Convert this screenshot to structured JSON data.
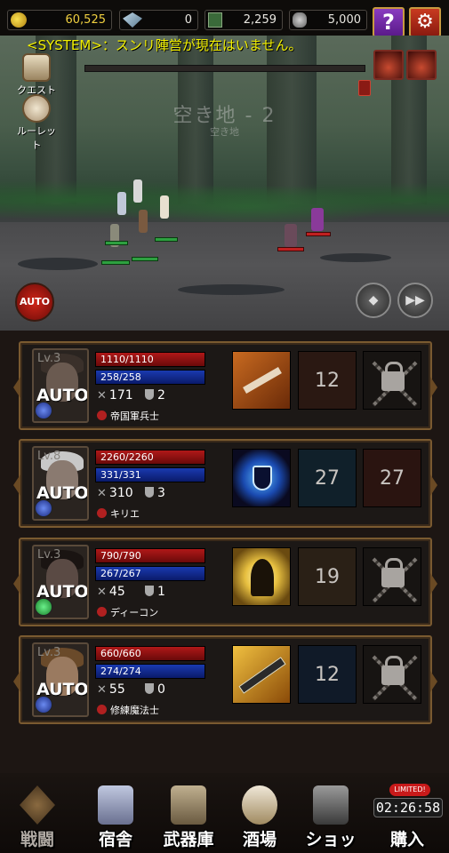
{
  "resources": {
    "gold": "60,525",
    "gems": "0",
    "cards": "2,259",
    "ore": "5,000"
  },
  "header": {
    "help_icon": "?",
    "settings_icon": "gear-icon"
  },
  "scene": {
    "system_message": "<SYSTEM>：スンリ陣営が現在はいません。",
    "stage_title": "空き地 - 2",
    "stage_subtitle": "空き地",
    "quest_label": "クエスト",
    "roulette_label": "ルーレット",
    "auto_button": "AUTO"
  },
  "heroes": [
    {
      "level": "Lv.3",
      "hp": "1110/1110",
      "mp": "258/258",
      "atk": "171",
      "def": "2",
      "name": "帝国軍兵士",
      "mode": "AUTO",
      "skill2": "12",
      "skill3_locked": true
    },
    {
      "level": "Lv.8",
      "hp": "2260/2260",
      "mp": "331/331",
      "atk": "310",
      "def": "3",
      "name": "キリエ",
      "mode": "AUTO",
      "skill2": "27",
      "skill3": "27"
    },
    {
      "level": "Lv.3",
      "hp": "790/790",
      "mp": "267/267",
      "atk": "45",
      "def": "1",
      "name": "ディーコン",
      "mode": "AUTO",
      "skill2": "19",
      "skill3_locked": true
    },
    {
      "level": "Lv.3",
      "hp": "660/660",
      "mp": "274/274",
      "atk": "55",
      "def": "0",
      "name": "修練魔法士",
      "mode": "AUTO",
      "skill2": "12",
      "skill3_locked": true
    }
  ],
  "nav": {
    "battle": "戦闘",
    "lodging": "宿舎",
    "armory": "武器庫",
    "tavern": "酒場",
    "shop": "ショップ",
    "purchase": "購入",
    "limited_badge": "LIMITED!",
    "timer": "02:26:58"
  },
  "colors": {
    "hp": "#b01818",
    "mp": "#1a3ab0",
    "system_text": "#f2f000",
    "frame": "#7a5a30"
  }
}
